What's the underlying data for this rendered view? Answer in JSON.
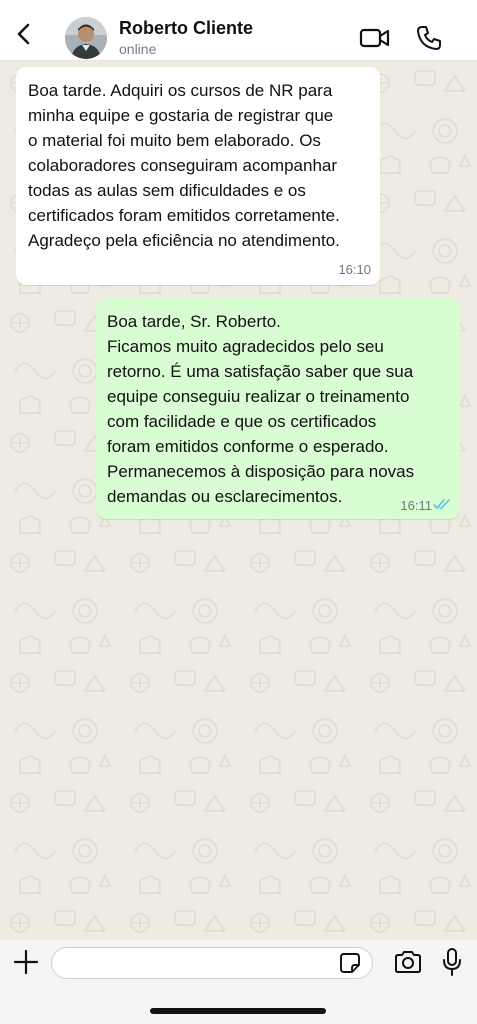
{
  "header": {
    "contact_name": "Roberto Cliente",
    "contact_status": "online"
  },
  "messages": [
    {
      "direction": "incoming",
      "text": "Boa tarde. Adquiri os cursos de NR para\nminha equipe e gostaria de registrar que\no material foi muito bem elaborado. Os\ncolaboradores conseguiram acompanhar\ntodas as aulas sem dificuldades e os\ncertificados foram emitidos corretamente.\nAgradeço pela eficiência no atendimento.",
      "time": "16:10"
    },
    {
      "direction": "outgoing",
      "text": "Boa tarde, Sr. Roberto.\nFicamos muito agradecidos pelo seu\nretorno. É uma satisfação saber que sua\nequipe conseguiu realizar o treinamento\ncom facilidade e que os certificados\nforam emitidos conforme o esperado.\nPermanecemos à disposição para novas\ndemandas ou esclarecimentos.",
      "time": "16:11",
      "status": "read"
    }
  ],
  "input": {
    "value": "",
    "placeholder": ""
  },
  "icons": {
    "back": "chevron-left-icon",
    "video": "video-camera-icon",
    "call": "phone-icon",
    "attach": "plus-icon",
    "sticker": "sticker-icon",
    "camera": "camera-icon",
    "mic": "microphone-icon",
    "read_receipt": "double-check-icon"
  },
  "colors": {
    "chat_background": "#efeae2",
    "incoming_bubble": "#ffffff",
    "outgoing_bubble": "#d9fdd3",
    "read_tick": "#53bdeb"
  }
}
